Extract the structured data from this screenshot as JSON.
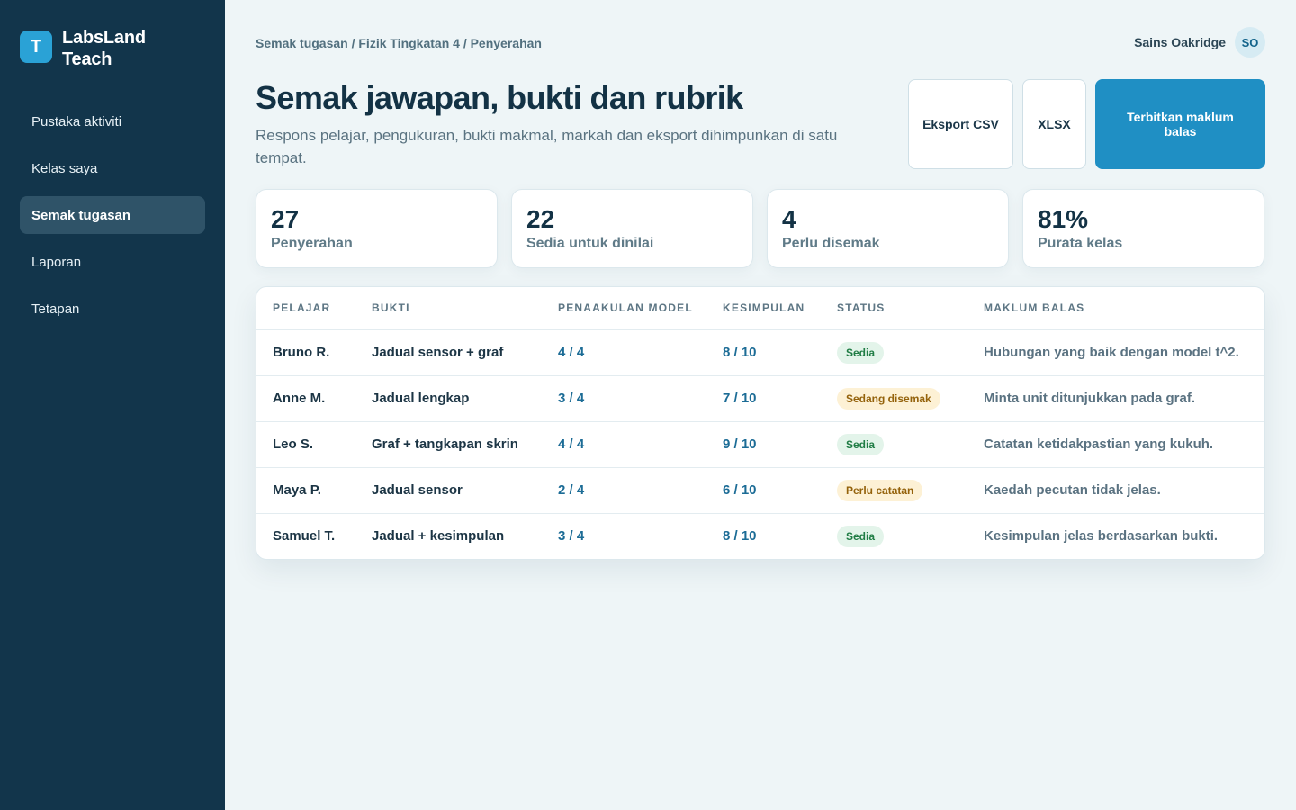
{
  "app": {
    "logo_letter": "T",
    "name_line1": "LabsLand",
    "name_line2": "Teach",
    "colors": {
      "sidebar": "#12354b",
      "accent": "#1f8fc4",
      "background": "#eef5f7"
    }
  },
  "sidebar": {
    "items": [
      {
        "label": "Pustaka aktiviti",
        "active": false
      },
      {
        "label": "Kelas saya",
        "active": false
      },
      {
        "label": "Semak tugasan",
        "active": true
      },
      {
        "label": "Laporan",
        "active": false
      },
      {
        "label": "Tetapan",
        "active": false
      }
    ]
  },
  "header": {
    "breadcrumb": "Semak tugasan / Fizik Tingkatan 4 / Penyerahan",
    "user_name": "Sains Oakridge",
    "user_initials": "SO"
  },
  "page": {
    "title": "Semak jawapan, bukti dan rubrik",
    "subtitle": "Respons pelajar, pengukuran, bukti makmal, markah dan eksport dihimpunkan di satu tempat."
  },
  "actions": {
    "export_csv": "Eksport CSV",
    "xlsx": "XLSX",
    "publish": "Terbitkan maklum balas"
  },
  "stats": [
    {
      "value": "27",
      "label": "Penyerahan"
    },
    {
      "value": "22",
      "label": "Sedia untuk dinilai"
    },
    {
      "value": "4",
      "label": "Perlu disemak"
    },
    {
      "value": "81%",
      "label": "Purata kelas"
    }
  ],
  "table": {
    "headers": [
      "PELAJAR",
      "BUKTI",
      "PENAAKULAN MODEL",
      "KESIMPULAN",
      "STATUS",
      "MAKLUM BALAS"
    ],
    "rows": [
      {
        "student": "Bruno R.",
        "evidence": "Jadual sensor + graf",
        "model": "4 / 4",
        "conclusion": "8 / 10",
        "status": "Sedia",
        "status_type": "ok",
        "feedback": "Hubungan yang baik dengan model t^2."
      },
      {
        "student": "Anne M.",
        "evidence": "Jadual lengkap",
        "model": "3 / 4",
        "conclusion": "7 / 10",
        "status": "Sedang disemak",
        "status_type": "warn",
        "feedback": "Minta unit ditunjukkan pada graf."
      },
      {
        "student": "Leo S.",
        "evidence": "Graf + tangkapan skrin",
        "model": "4 / 4",
        "conclusion": "9 / 10",
        "status": "Sedia",
        "status_type": "ok",
        "feedback": "Catatan ketidakpastian yang kukuh."
      },
      {
        "student": "Maya P.",
        "evidence": "Jadual sensor",
        "model": "2 / 4",
        "conclusion": "6 / 10",
        "status": "Perlu catatan",
        "status_type": "warn",
        "feedback": "Kaedah pecutan tidak jelas."
      },
      {
        "student": "Samuel T.",
        "evidence": "Jadual + kesimpulan",
        "model": "3 / 4",
        "conclusion": "8 / 10",
        "status": "Sedia",
        "status_type": "ok",
        "feedback": "Kesimpulan jelas berdasarkan bukti."
      }
    ]
  }
}
